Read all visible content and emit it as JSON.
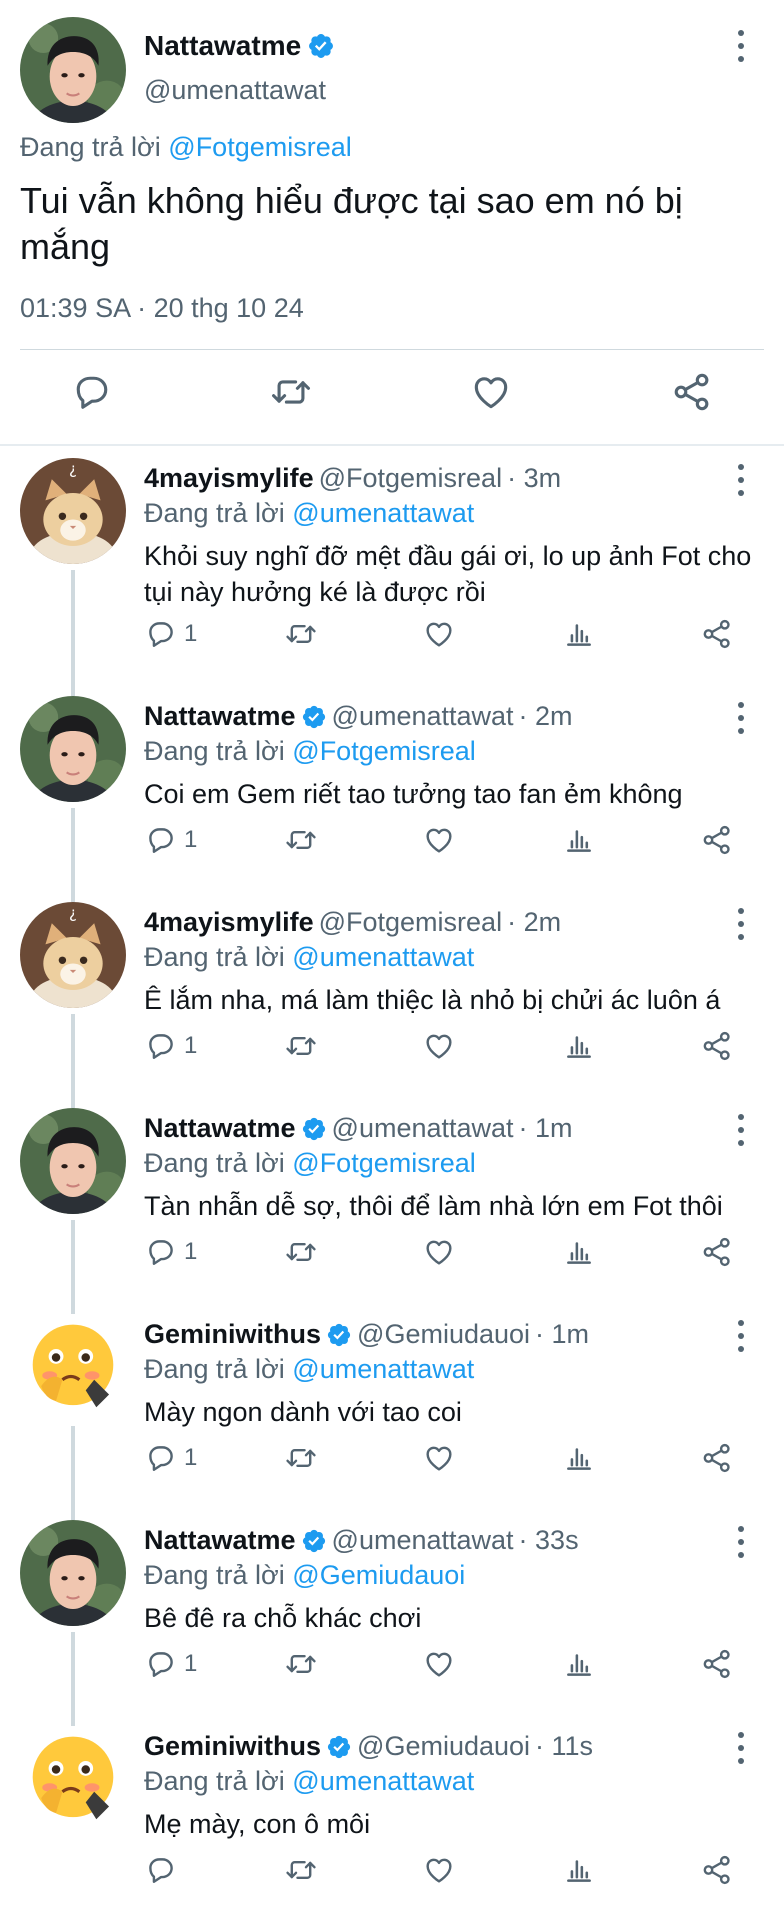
{
  "main_tweet": {
    "name": "Nattawatme",
    "handle": "@umenattawat",
    "reply_prefix": "Đang trả lời",
    "reply_to": "@Fotgemisreal",
    "text": "Tui vẫn không hiểu được tại sao em nó bị mắng",
    "timestamp": "01:39 SA · 20 thg 10 24",
    "actions": [
      "reply-icon",
      "retweet-icon",
      "like-icon",
      "share-icon"
    ]
  },
  "replies": [
    {
      "name": "4mayismylife",
      "verified": false,
      "handle": "@Fotgemisreal",
      "time": "· 3m",
      "reply_prefix": "Đang trả lời",
      "reply_to": "@umenattawat",
      "text": "Khỏi suy nghĩ đỡ mệt đầu gái ơi, lo up ảnh Fot cho tụi này hưởng ké là được rồi",
      "reply_count": "1",
      "avatar": "cat"
    },
    {
      "name": "Nattawatme",
      "verified": true,
      "handle": "@umenattawat",
      "time": "· 2m",
      "reply_prefix": "Đang trả lời",
      "reply_to": "@Fotgemisreal",
      "text": "Coi em Gem riết tao tưởng tao fan ẻm không",
      "reply_count": "1",
      "avatar": "man"
    },
    {
      "name": "4mayismylife",
      "verified": false,
      "handle": "@Fotgemisreal",
      "time": "· 2m",
      "reply_prefix": "Đang trả lời",
      "reply_to": "@umenattawat",
      "text": "Ê lắm nha, má làm thiệc là nhỏ bị chửi ác luôn á",
      "reply_count": "1",
      "avatar": "cat"
    },
    {
      "name": "Nattawatme",
      "verified": true,
      "handle": "@umenattawat",
      "time": "· 1m",
      "reply_prefix": "Đang trả lời",
      "reply_to": "@Fotgemisreal",
      "text": "Tàn nhẫn dễ sợ, thôi để làm nhà lớn em Fot thôi",
      "reply_count": "1",
      "avatar": "man"
    },
    {
      "name": "Geminiwithus",
      "verified": true,
      "handle": "@Gemiudauoi",
      "time": "· 1m",
      "reply_prefix": "Đang trả lời",
      "reply_to": "@umenattawat",
      "text": "Mày ngon dành với tao coi",
      "reply_count": "1",
      "avatar": "emoji"
    },
    {
      "name": "Nattawatme",
      "verified": true,
      "handle": "@umenattawat",
      "time": "· 33s",
      "reply_prefix": "Đang trả lời",
      "reply_to": "@Gemiudauoi",
      "text": "Bê đê ra chỗ khác chơi",
      "reply_count": "1",
      "avatar": "man"
    },
    {
      "name": "Geminiwithus",
      "verified": true,
      "handle": "@Gemiudauoi",
      "time": "· 11s",
      "reply_prefix": "Đang trả lời",
      "reply_to": "@umenattawat",
      "text": "Mẹ mày, con ô môi",
      "reply_count": "",
      "avatar": "emoji"
    }
  ],
  "colors": {
    "accent": "#1d9bf0",
    "secondary_text": "#536471",
    "divider": "#cfd9de"
  },
  "icons": [
    "verified-icon",
    "more-icon",
    "reply-icon",
    "retweet-icon",
    "like-icon",
    "views-icon",
    "share-icon"
  ]
}
